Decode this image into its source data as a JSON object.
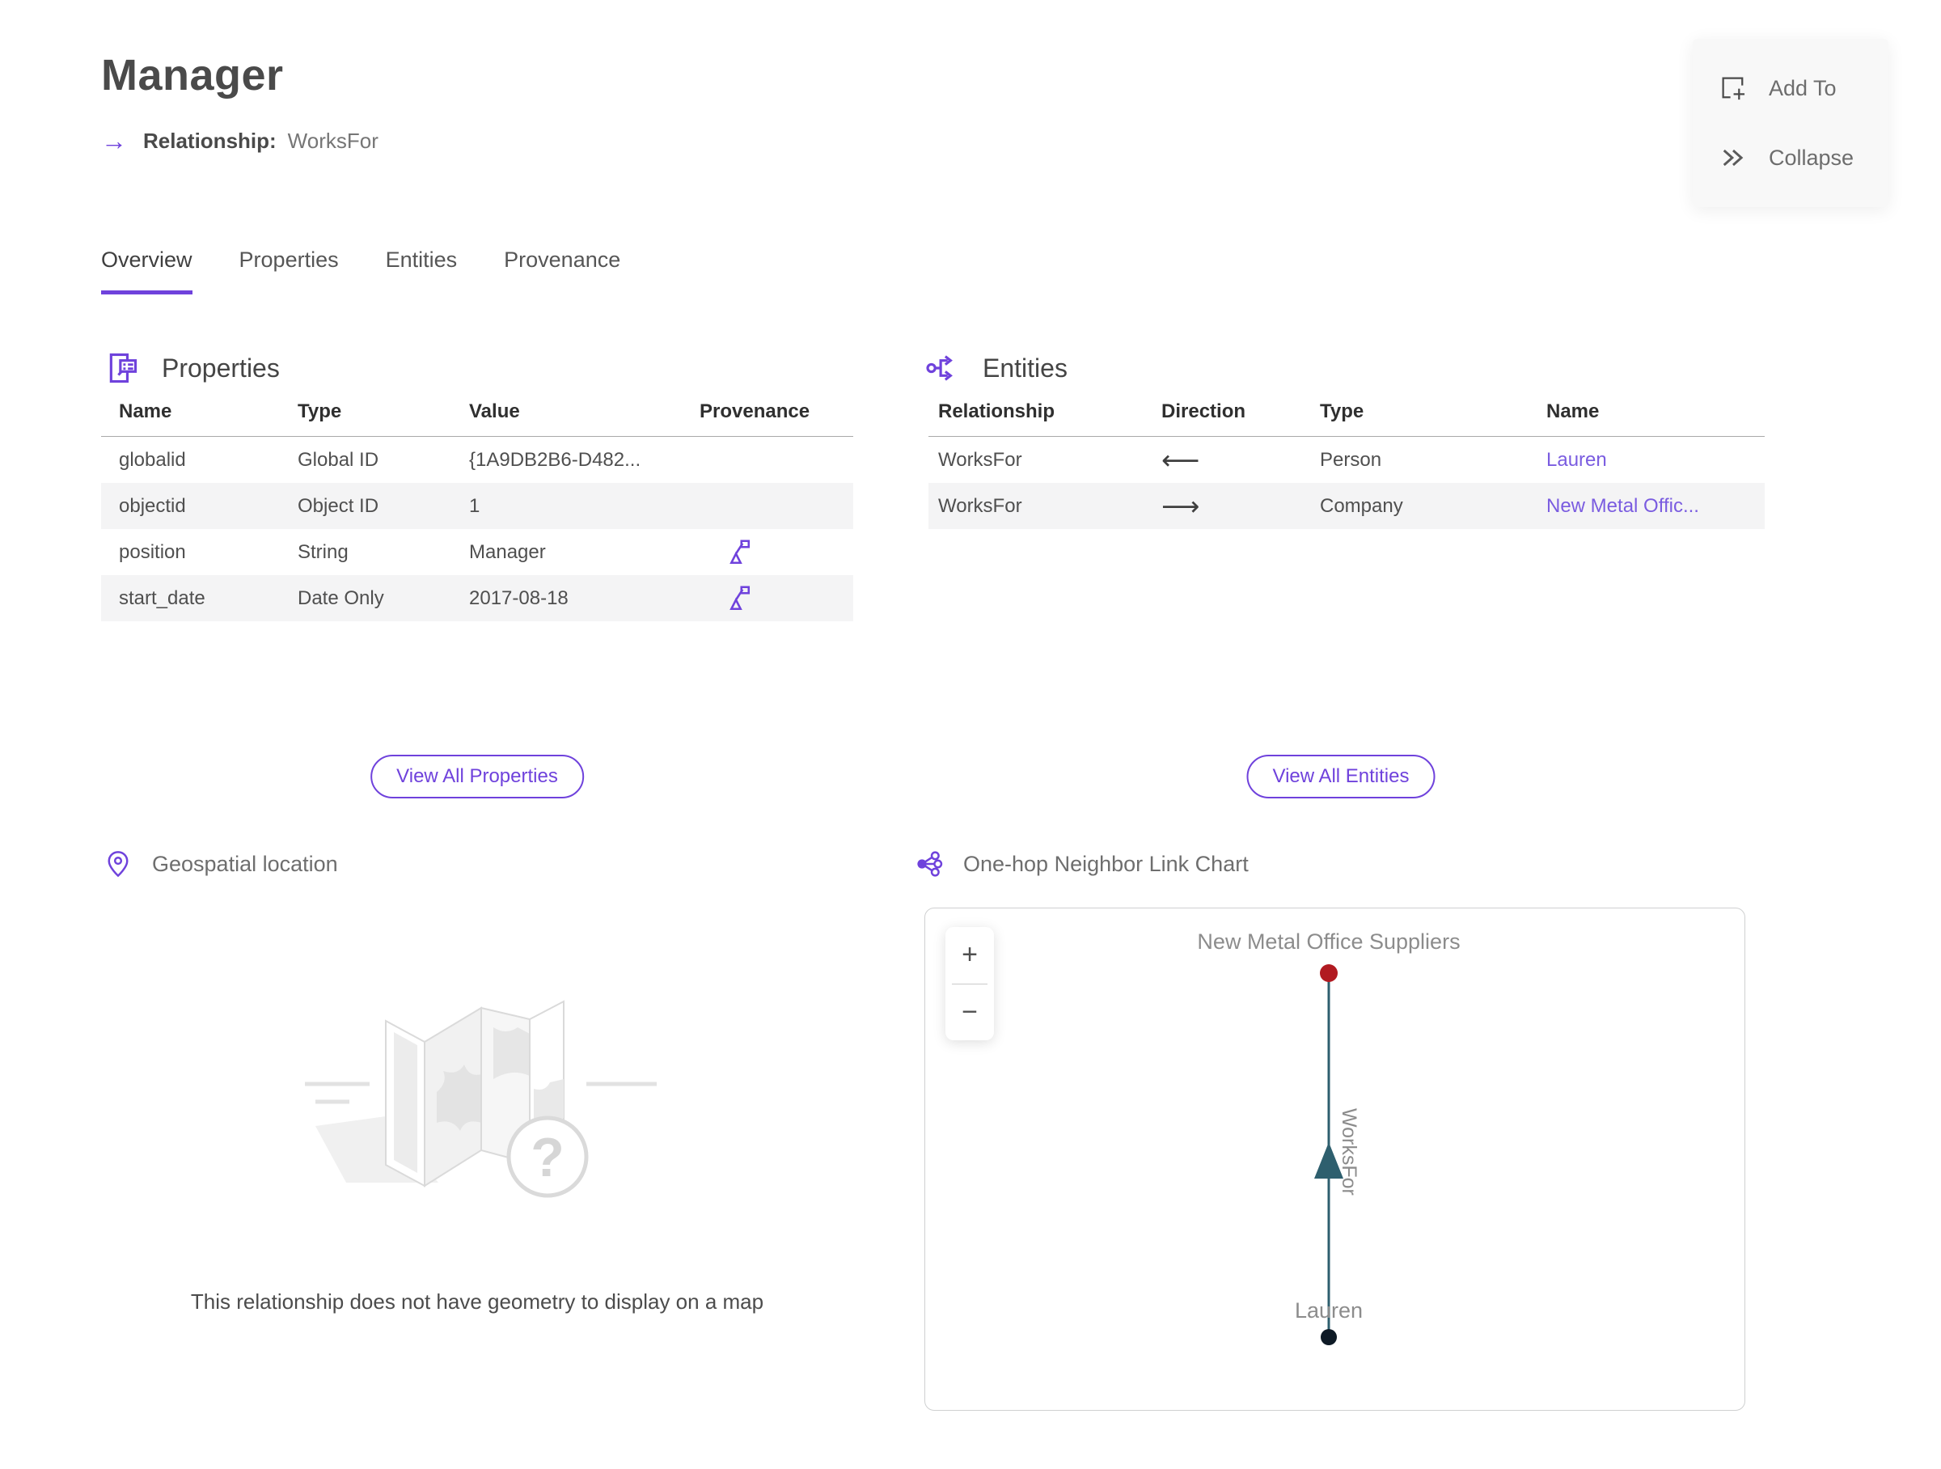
{
  "header": {
    "title": "Manager",
    "relationship_label": "Relationship:",
    "relationship_value": "WorksFor"
  },
  "actions": {
    "add_to": "Add To",
    "collapse": "Collapse"
  },
  "tabs": [
    {
      "label": "Overview",
      "active": true
    },
    {
      "label": "Properties",
      "active": false
    },
    {
      "label": "Entities",
      "active": false
    },
    {
      "label": "Provenance",
      "active": false
    }
  ],
  "properties_section": {
    "title": "Properties",
    "columns": [
      "Name",
      "Type",
      "Value",
      "Provenance"
    ],
    "rows": [
      {
        "name": "globalid",
        "type": "Global ID",
        "value": "{1A9DB2B6-D482..."
      },
      {
        "name": "objectid",
        "type": "Object ID",
        "value": "1"
      },
      {
        "name": "position",
        "type": "String",
        "value": "Manager"
      },
      {
        "name": "start_date",
        "type": "Date Only",
        "value": "2017-08-18"
      }
    ],
    "view_all_label": "View All Properties"
  },
  "entities_section": {
    "title": "Entities",
    "columns": [
      "Relationship",
      "Direction",
      "Type",
      "Name"
    ],
    "rows": [
      {
        "relationship": "WorksFor",
        "direction": "⟵",
        "type": "Person",
        "name": "Lauren"
      },
      {
        "relationship": "WorksFor",
        "direction": "⟶",
        "type": "Company",
        "name": "New Metal Offic..."
      }
    ],
    "view_all_label": "View All Entities"
  },
  "geospatial_section": {
    "title": "Geospatial location",
    "empty_message": "This relationship does not have geometry to display on a map"
  },
  "link_chart_section": {
    "title": "One-hop Neighbor Link Chart",
    "zoom_in_label": "+",
    "zoom_out_label": "−",
    "nodes": [
      {
        "label": "New Metal Office Suppliers",
        "color": "#b11a21"
      },
      {
        "label": "Lauren",
        "color": "#0e1a26"
      }
    ],
    "edge": {
      "label": "WorksFor",
      "color": "#2e5f6e"
    }
  },
  "colors": {
    "accent": "#6f42dc",
    "link": "#7a5ce0",
    "node_red": "#b11a21",
    "node_dark": "#0e1a26",
    "edge_teal": "#2e5f6e"
  }
}
